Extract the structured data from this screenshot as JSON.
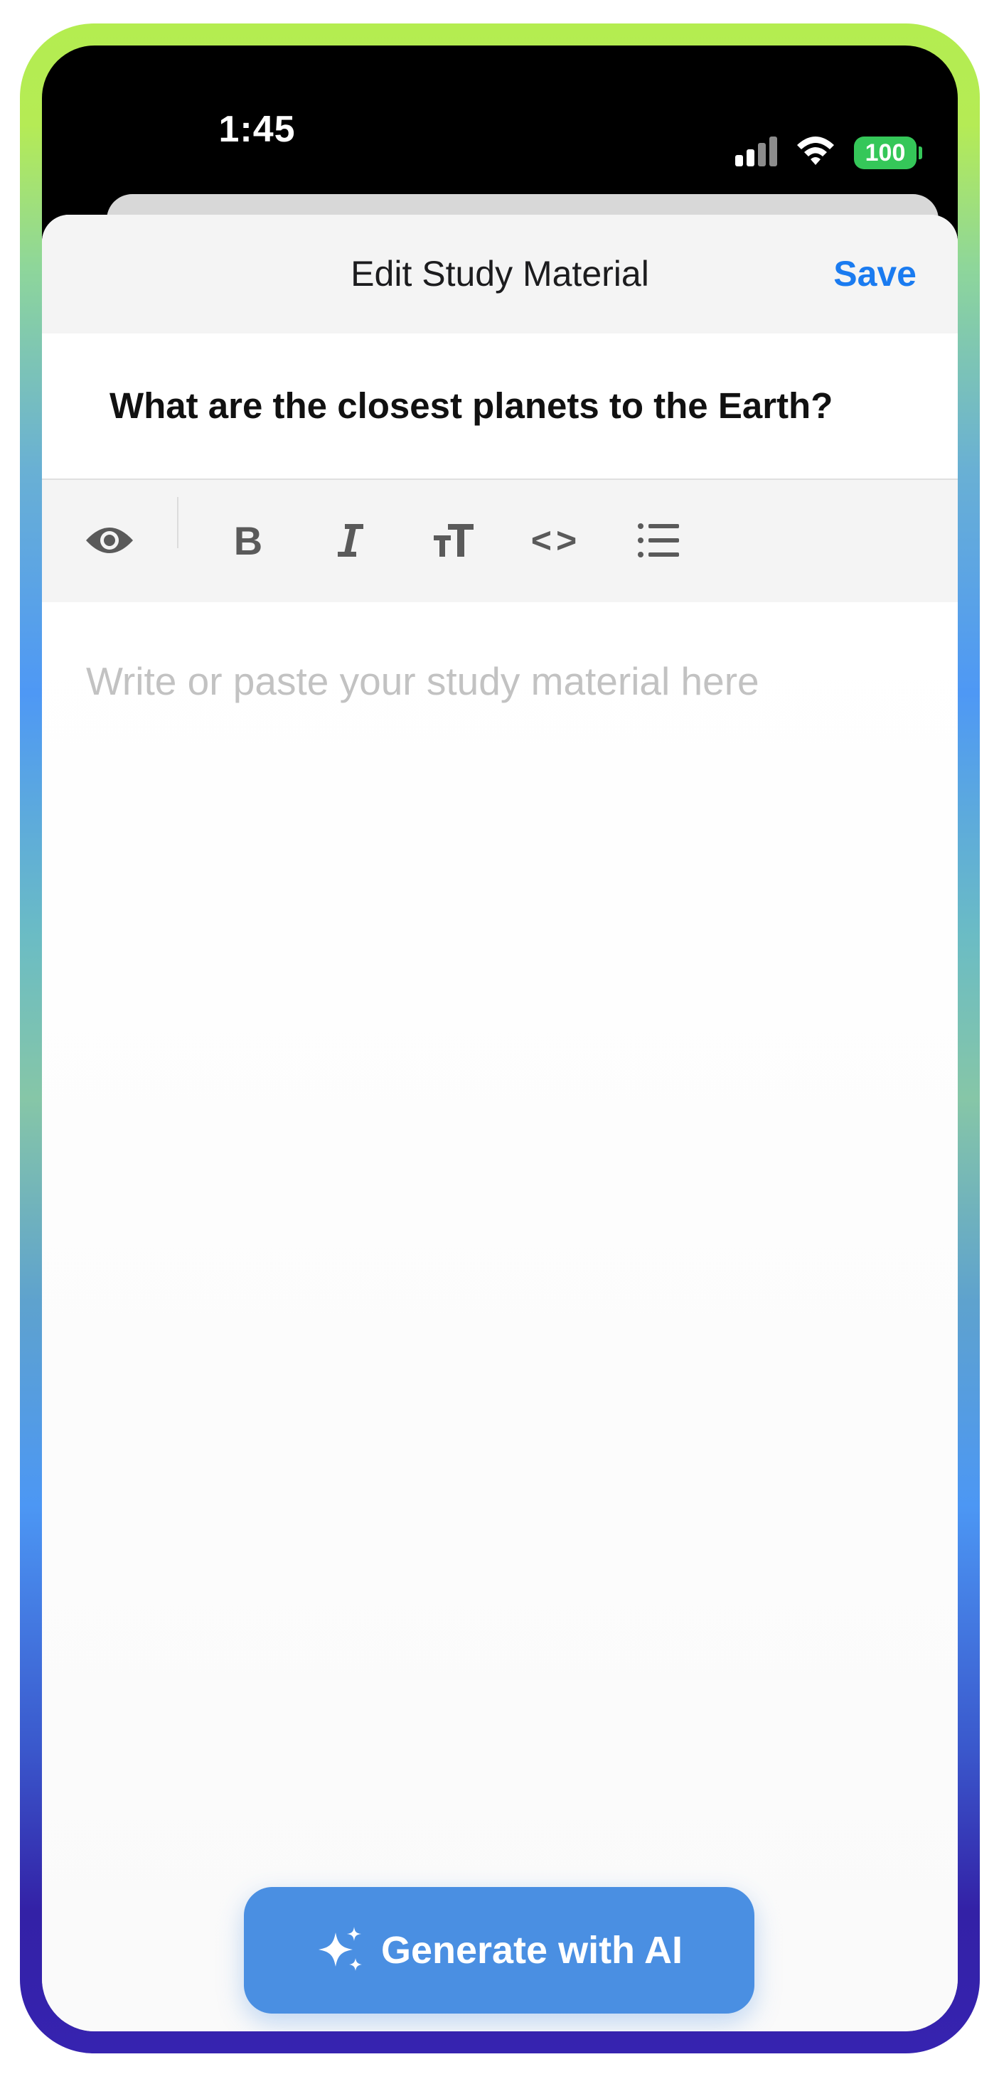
{
  "status_bar": {
    "time": "1:45",
    "battery": "100",
    "icons": [
      "signal-icon",
      "wifi-icon",
      "battery-icon"
    ],
    "battery_color": "#35c759"
  },
  "nav": {
    "title": "Edit Study Material",
    "save_label": "Save"
  },
  "material": {
    "title": "What are the closest planets to the Earth?"
  },
  "toolbar": {
    "items": [
      {
        "name": "preview",
        "icon": "eye-icon"
      },
      {
        "name": "bold",
        "icon": "bold-icon",
        "glyph": "B"
      },
      {
        "name": "italic",
        "icon": "italic-icon",
        "glyph": "I"
      },
      {
        "name": "heading",
        "icon": "text-size-icon"
      },
      {
        "name": "code",
        "icon": "code-icon",
        "glyph": "<>"
      },
      {
        "name": "list",
        "icon": "list-icon"
      }
    ]
  },
  "editor": {
    "placeholder": "Write or paste your study material here",
    "value": ""
  },
  "generate": {
    "label": "Generate with AI",
    "icon": "sparkles-icon"
  },
  "colors": {
    "accent": "#1a7bf0",
    "button": "#4a8fe2",
    "toolbar_bg": "#f4f4f4",
    "placeholder": "#c2c2c2"
  }
}
